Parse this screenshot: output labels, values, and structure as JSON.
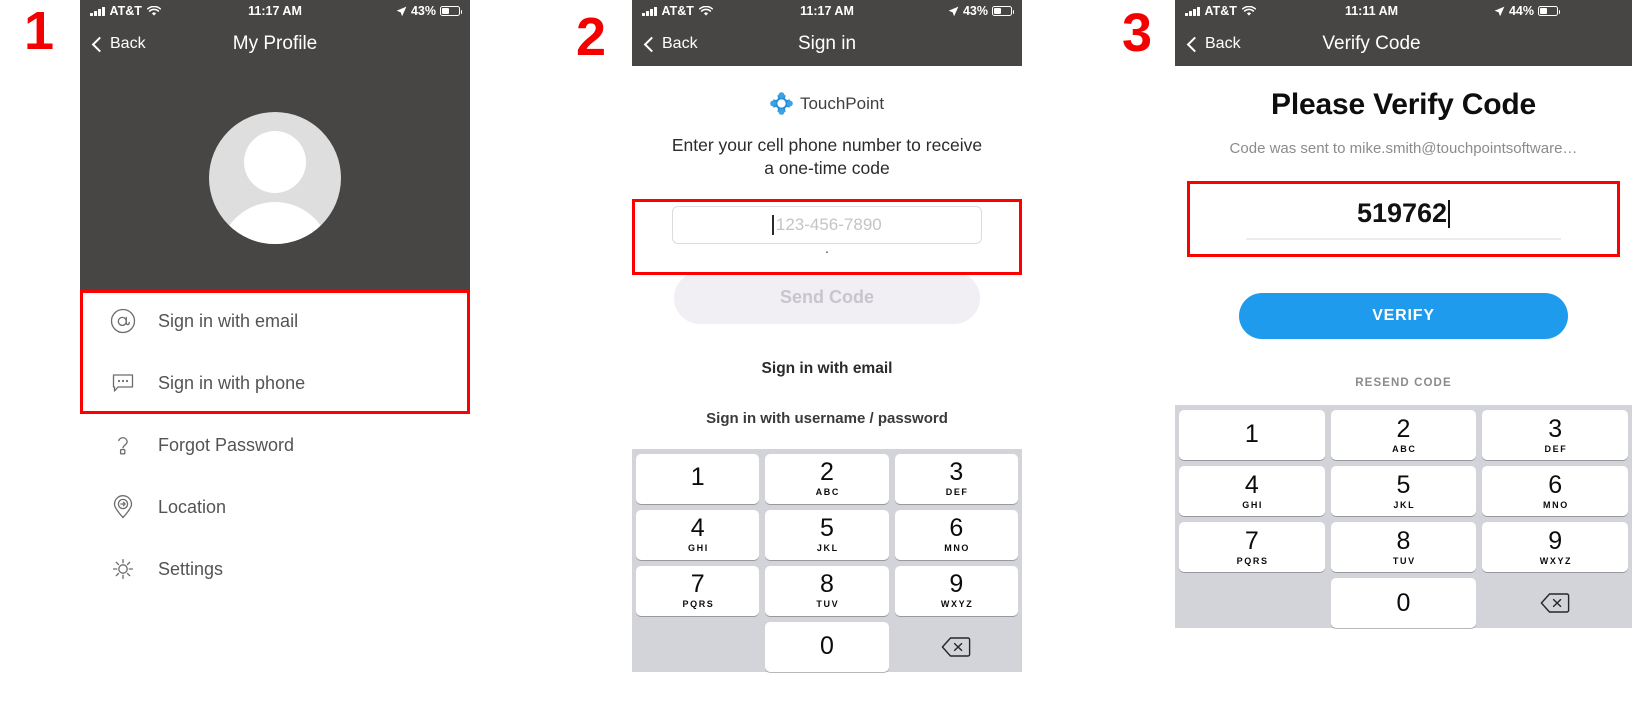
{
  "steps": [
    {
      "number": "1"
    },
    {
      "number": "2"
    },
    {
      "number": "3"
    }
  ],
  "colors": {
    "nav_background": "#474644",
    "annotation_red": "#fd0000",
    "verify_blue": "#1f9bee",
    "send_code_disabled_bg": "#f1eef4",
    "keypad_background": "#d2d4d9"
  },
  "panel1": {
    "status_bar": {
      "carrier": "AT&T",
      "time": "11:17 AM",
      "battery_percent": "43%",
      "signal_icon": "signal-bars-icon",
      "wifi_icon": "wifi-icon",
      "location_icon": "location-arrow-icon",
      "battery_icon": "battery-icon"
    },
    "nav": {
      "back_label": "Back",
      "title": "My Profile",
      "back_icon": "chevron-left-icon"
    },
    "avatar_icon": "default-avatar-icon",
    "menu": [
      {
        "label": "Sign in with email",
        "icon": "at-sign-icon"
      },
      {
        "label": "Sign in with phone",
        "icon": "chat-bubble-icon"
      },
      {
        "label": "Forgot Password",
        "icon": "question-mark-key-icon"
      },
      {
        "label": "Location",
        "icon": "location-pin-icon"
      },
      {
        "label": "Settings",
        "icon": "gear-icon"
      }
    ]
  },
  "panel2": {
    "status_bar": {
      "carrier": "AT&T",
      "time": "11:17 AM",
      "battery_percent": "43%"
    },
    "nav": {
      "back_label": "Back",
      "title": "Sign in"
    },
    "logo": {
      "icon": "touchpoint-logo-icon",
      "text": "TouchPoint"
    },
    "prompt": "Enter your cell phone number to receive a one-time code",
    "phone_input": {
      "value": "",
      "placeholder": "123-456-7890"
    },
    "dot_marker": "·",
    "send_code_label": "Send Code",
    "link_email": "Sign in with email",
    "link_username": "Sign in with username / password"
  },
  "panel3": {
    "status_bar": {
      "carrier": "AT&T",
      "time": "11:11 AM",
      "battery_percent": "44%"
    },
    "nav": {
      "back_label": "Back",
      "title": "Verify Code"
    },
    "heading": "Please Verify Code",
    "sent_to": "Code was sent to mike.smith@touchpointsoftware…",
    "code_value": "519762",
    "verify_label": "VERIFY",
    "resend_label": "RESEND CODE"
  },
  "keypad": {
    "keys": [
      {
        "num": "1",
        "sub": ""
      },
      {
        "num": "2",
        "sub": "ABC"
      },
      {
        "num": "3",
        "sub": "DEF"
      },
      {
        "num": "4",
        "sub": "GHI"
      },
      {
        "num": "5",
        "sub": "JKL"
      },
      {
        "num": "6",
        "sub": "MNO"
      },
      {
        "num": "7",
        "sub": "PQRS"
      },
      {
        "num": "8",
        "sub": "TUV"
      },
      {
        "num": "9",
        "sub": "WXYZ"
      },
      {
        "num": "0",
        "sub": ""
      }
    ],
    "delete_icon": "backspace-icon"
  }
}
